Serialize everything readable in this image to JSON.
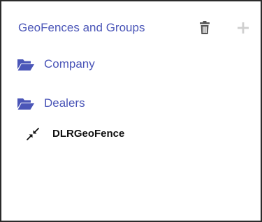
{
  "panel": {
    "title": "GeoFences and Groups",
    "delete_icon": "trash-icon",
    "add_icon": "plus-icon"
  },
  "tree": {
    "groups": [
      {
        "label": "Company",
        "icon": "folder-open-icon"
      },
      {
        "label": "Dealers",
        "icon": "folder-open-icon"
      }
    ],
    "geofences": [
      {
        "label": "DLRGeoFence",
        "icon": "compress-arrows-icon"
      }
    ]
  },
  "colors": {
    "accent": "#4b56b8",
    "icon_muted": "#555555",
    "icon_disabled": "#cfcfcf",
    "border": "#2b2b2b"
  }
}
